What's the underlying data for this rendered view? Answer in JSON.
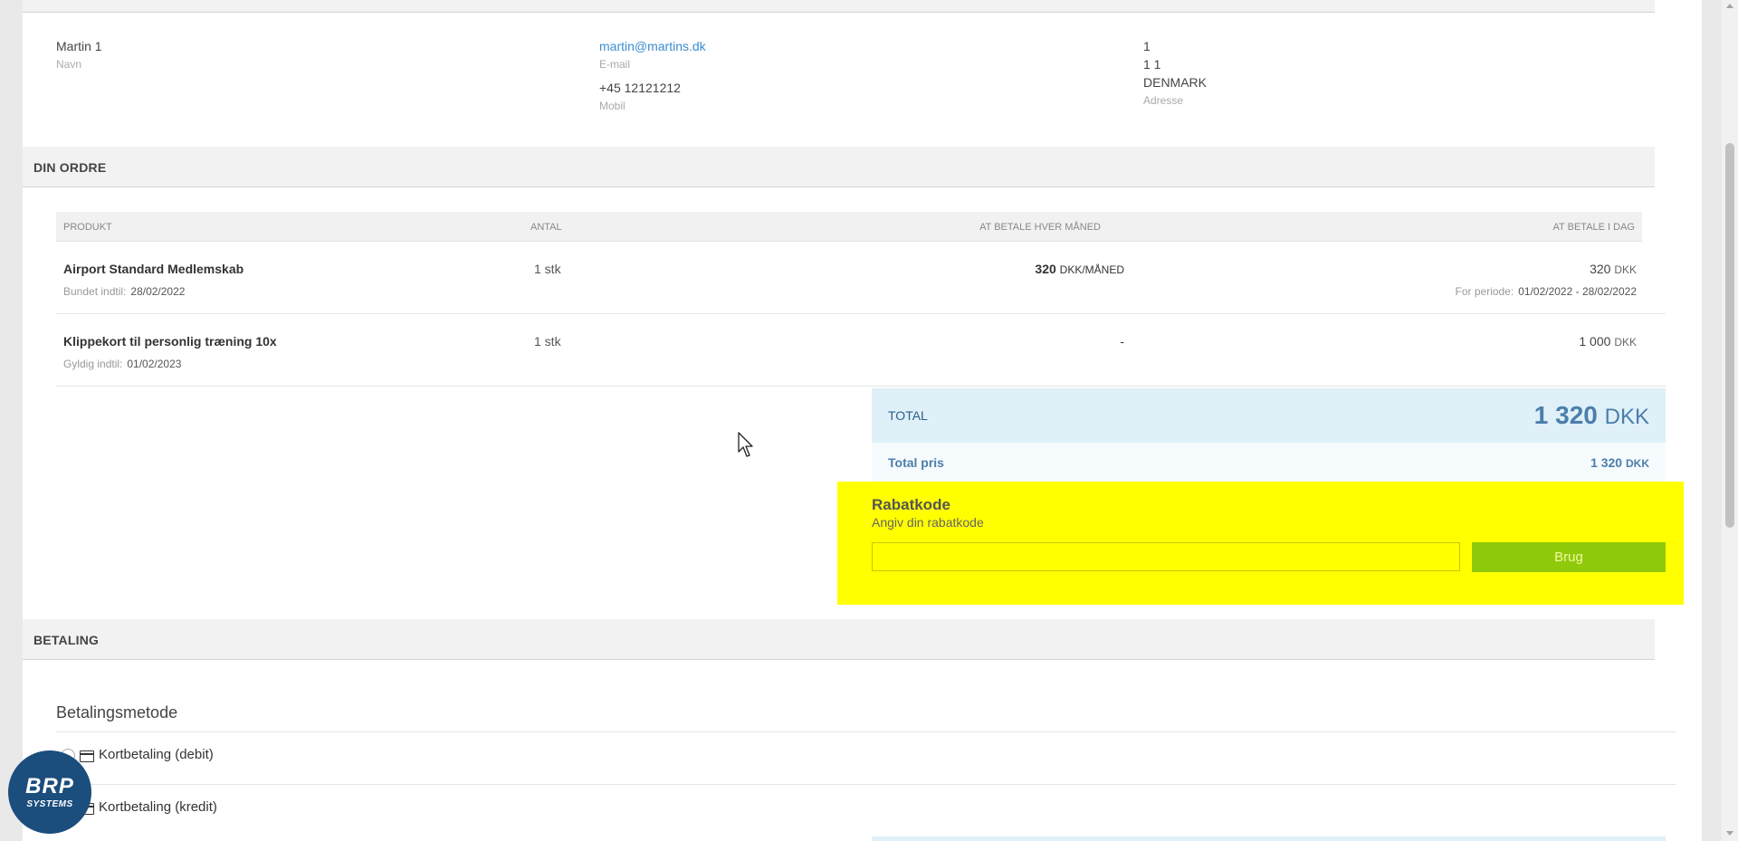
{
  "customer": {
    "name": "Martin 1",
    "name_label": "Navn",
    "email": "martin@martins.dk",
    "email_label": "E-mail",
    "mobile": "+45 12121212",
    "mobile_label": "Mobil",
    "address_line1": "1",
    "address_line2": "1 1",
    "address_country": "DENMARK",
    "address_label": "Adresse"
  },
  "order": {
    "section_title": "DIN ORDRE",
    "columns": {
      "product": "PRODUKT",
      "qty": "ANTAL",
      "monthly": "AT BETALE HVER MÅNED",
      "today": "AT BETALE I DAG"
    },
    "rows": [
      {
        "product": "Airport Standard Medlemskab",
        "sub_label": "Bundet indtil:",
        "sub_value": "28/02/2022",
        "qty": "1 stk",
        "monthly_amount": "320",
        "monthly_unit": "DKK/MÅNED",
        "today_amount": "320",
        "today_unit": "DKK",
        "period_label": "For periode:",
        "period_value": "01/02/2022 - 28/02/2022"
      },
      {
        "product": "Klippekort til personlig træning 10x",
        "sub_label": "Gyldig indtil:",
        "sub_value": "01/02/2023",
        "qty": "1 stk",
        "monthly_dash": "-",
        "today_amount": "1 000",
        "today_unit": "DKK"
      }
    ],
    "total_label": "TOTAL",
    "total_amount": "1 320",
    "total_unit": "DKK",
    "totalpris_label": "Total pris",
    "totalpris_amount": "1 320",
    "totalpris_unit": "DKK"
  },
  "discount": {
    "title": "Rabatkode",
    "subtitle": "Angiv din rabatkode",
    "input_value": "",
    "button_label": "Brug"
  },
  "payment": {
    "section_title": "BETALING",
    "method_title": "Betalingsmetode",
    "methods": [
      "Kortbetaling (debit)",
      "Kortbetaling (kredit)"
    ]
  },
  "logo": {
    "big": "BRP",
    "small": "SYSTEMS"
  },
  "colors": {
    "highlight": "#ffff00",
    "button": "#8fca0a",
    "total_bg": "#dff0f8",
    "link": "#3a8dd0"
  }
}
